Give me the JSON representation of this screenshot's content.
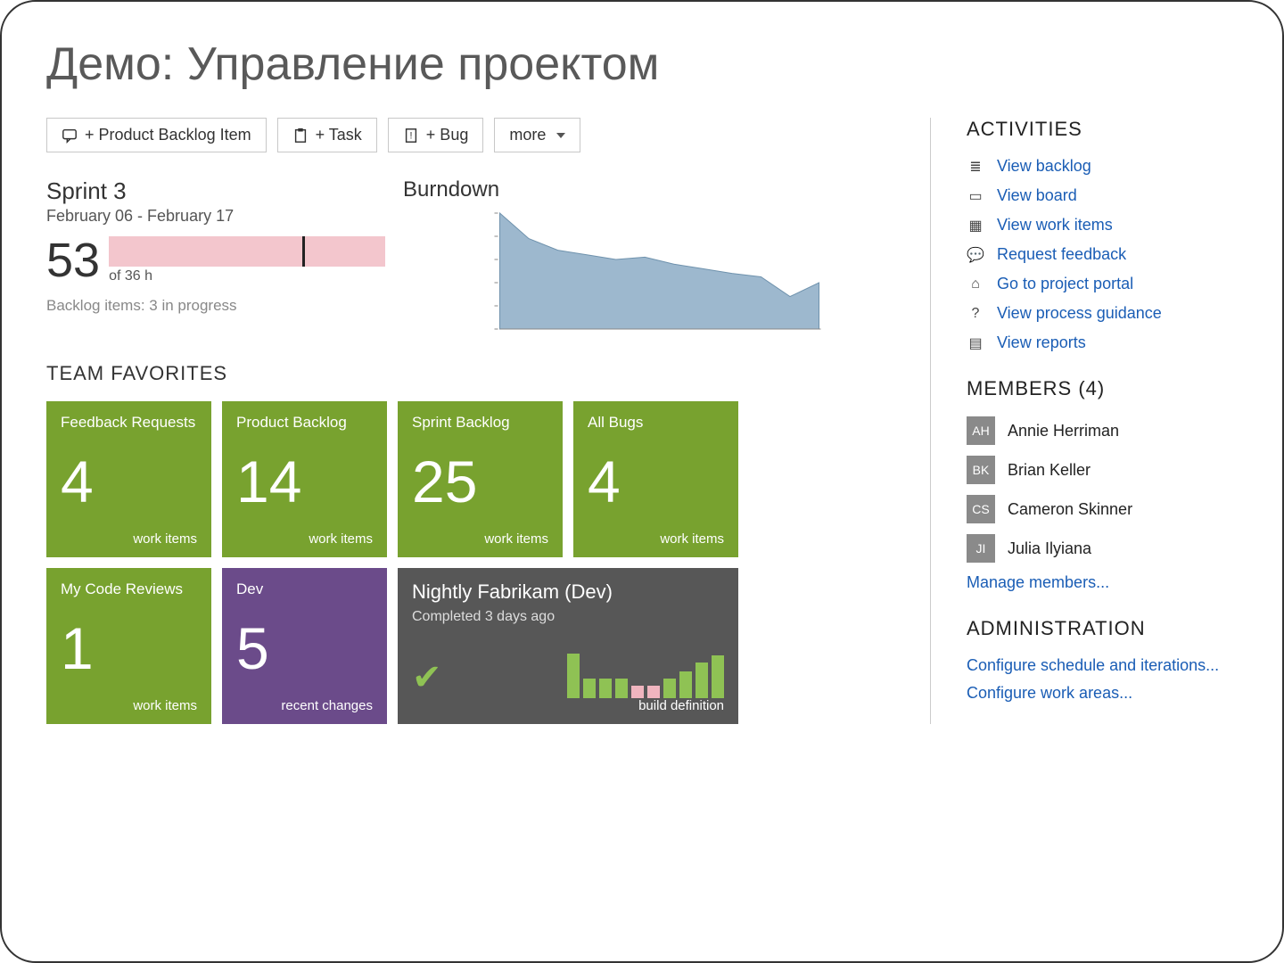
{
  "slide_title": "Демо: Управление проектом",
  "toolbar": {
    "product_backlog": "+ Product Backlog Item",
    "task": "+ Task",
    "bug": "+ Bug",
    "more": "more"
  },
  "sprint": {
    "title": "Sprint 3",
    "dates": "February 06 - February 17",
    "big_number": "53",
    "of_hours": "of 36 h",
    "backlog_progress": "Backlog items: 3 in progress",
    "bar_mark_pct": 70
  },
  "burndown": {
    "title": "Burndown"
  },
  "team_favorites_header": "TEAM FAVORITES",
  "tiles": [
    {
      "title": "Feedback Requests",
      "value": "4",
      "footer": "work items",
      "color": "green"
    },
    {
      "title": "Product Backlog",
      "value": "14",
      "footer": "work items",
      "color": "green"
    },
    {
      "title": "Sprint Backlog",
      "value": "25",
      "footer": "work items",
      "color": "green"
    },
    {
      "title": "All Bugs",
      "value": "4",
      "footer": "work items",
      "color": "green"
    },
    {
      "title": "My Code Reviews",
      "value": "1",
      "footer": "work items",
      "color": "green"
    },
    {
      "title": "Dev",
      "value": "5",
      "footer": "recent changes",
      "color": "purple"
    }
  ],
  "build_tile": {
    "title": "Nightly Fabrikam (Dev)",
    "subtitle": "Completed 3 days ago",
    "footer": "build definition",
    "bars": [
      {
        "h": 50,
        "c": "green"
      },
      {
        "h": 22,
        "c": "green"
      },
      {
        "h": 22,
        "c": "green"
      },
      {
        "h": 22,
        "c": "green"
      },
      {
        "h": 14,
        "c": "pink"
      },
      {
        "h": 14,
        "c": "pink"
      },
      {
        "h": 22,
        "c": "green"
      },
      {
        "h": 30,
        "c": "green"
      },
      {
        "h": 40,
        "c": "green"
      },
      {
        "h": 48,
        "c": "green"
      }
    ]
  },
  "activities": {
    "header": "ACTIVITIES",
    "items": [
      {
        "label": "View backlog",
        "icon": "list-icon"
      },
      {
        "label": "View board",
        "icon": "board-icon"
      },
      {
        "label": "View work items",
        "icon": "grid-icon"
      },
      {
        "label": "Request feedback",
        "icon": "feedback-icon"
      },
      {
        "label": "Go to project portal",
        "icon": "portal-icon"
      },
      {
        "label": "View process guidance",
        "icon": "help-icon"
      },
      {
        "label": "View reports",
        "icon": "report-icon"
      }
    ]
  },
  "members": {
    "header": "MEMBERS (4)",
    "people": [
      {
        "name": "Annie Herriman",
        "initials": "AH"
      },
      {
        "name": "Brian Keller",
        "initials": "BK"
      },
      {
        "name": "Cameron Skinner",
        "initials": "CS"
      },
      {
        "name": "Julia Ilyiana",
        "initials": "JI"
      }
    ],
    "manage": "Manage members..."
  },
  "admin": {
    "header": "ADMINISTRATION",
    "links": [
      "Configure schedule and iterations...",
      "Configure work areas..."
    ]
  },
  "chart_data": {
    "type": "area",
    "title": "Burndown",
    "x": [
      0,
      1,
      2,
      3,
      4,
      5,
      6,
      7,
      8,
      9,
      10,
      11
    ],
    "values": [
      100,
      78,
      68,
      64,
      60,
      62,
      56,
      52,
      48,
      45,
      28,
      40
    ],
    "ylim": [
      0,
      100
    ],
    "xlabel": "",
    "ylabel": ""
  }
}
